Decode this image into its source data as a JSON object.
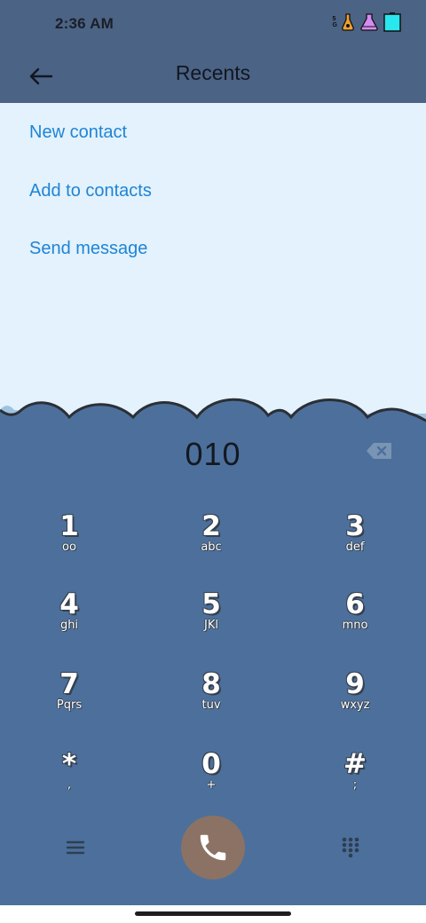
{
  "status_bar": {
    "time": "2:36 AM",
    "network_label": "5G",
    "icons": [
      "5g-signal-icon",
      "flask-orange-icon",
      "flask-purple-icon",
      "battery-icon"
    ],
    "battery_color": "#29e6ef"
  },
  "app_bar": {
    "back_icon": "arrow-left-icon",
    "title": "Recents"
  },
  "options": [
    {
      "label": "New contact"
    },
    {
      "label": "Add to contacts"
    },
    {
      "label": "Send message"
    }
  ],
  "dialpad": {
    "number": "010",
    "backspace_icon": "backspace-icon",
    "keys": [
      {
        "digit": "1",
        "letters": "oo"
      },
      {
        "digit": "2",
        "letters": "abc"
      },
      {
        "digit": "3",
        "letters": "def"
      },
      {
        "digit": "4",
        "letters": "ghi"
      },
      {
        "digit": "5",
        "letters": "JKl"
      },
      {
        "digit": "6",
        "letters": "mno"
      },
      {
        "digit": "7",
        "letters": "Pqrs"
      },
      {
        "digit": "8",
        "letters": "tuv"
      },
      {
        "digit": "9",
        "letters": "wxyz"
      },
      {
        "digit": "*",
        "letters": ","
      },
      {
        "digit": "0",
        "letters": "+"
      },
      {
        "digit": "#",
        "letters": ";"
      }
    ]
  },
  "bottom_actions": {
    "menu_icon": "hamburger-menu-icon",
    "call_icon": "phone-icon",
    "dialpad_icon": "dialpad-grid-icon"
  },
  "colors": {
    "header_bg": "#4b6384",
    "options_bg": "#e3f2fc",
    "link_text": "#1f84d6",
    "dialpad_bg": "#4c709b",
    "call_button": "#8c7264"
  }
}
